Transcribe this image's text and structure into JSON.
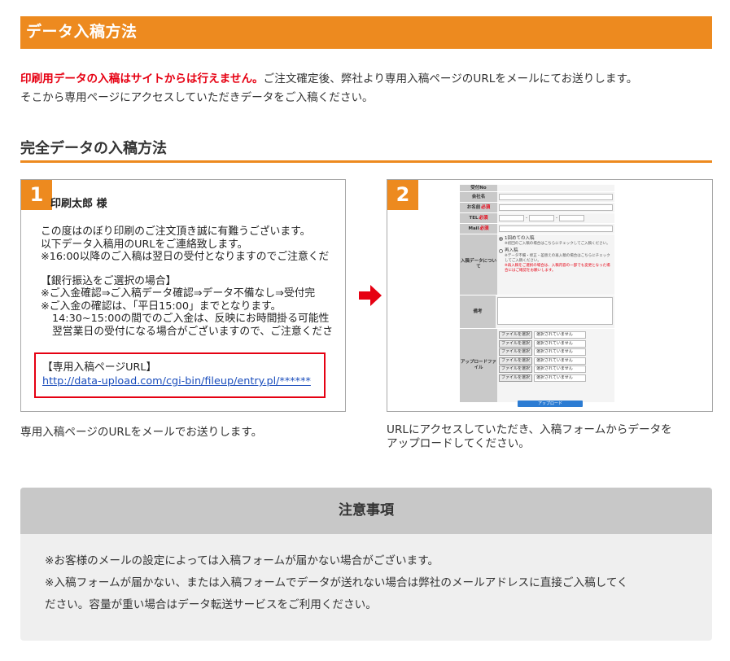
{
  "section": {
    "title": "データ入稿方法"
  },
  "intro": {
    "warning": "印刷用データの入稿はサイトからは行えません。",
    "text1": "ご注文確定後、弊社より専用入稿ページのURLをメールにてお送りします。",
    "text2": "そこから専用ページにアクセスしていただきデータをご入稿ください。"
  },
  "subsection": {
    "title": "完全データの入稿方法"
  },
  "step1": {
    "number": "1",
    "recipient": "印刷太郎  様",
    "lines": [
      "この度はのぼり印刷のご注文頂き誠に有難うございます。",
      "以下データ入稿用のURLをご連絡致します。",
      "※16:00以降のご入稿は翌日の受付となりますのでご注意くだ"
    ],
    "bank_lines": [
      "【銀行振込をご選択の場合】",
      "※ご入金確認⇒ご入稿データ確認⇒データ不備なし⇒受付完",
      "※ご入金の確認は、「平日15:00」までとなります。",
      "14:30~15:00の間でのご入金は、反映にお時間掛る可能性",
      "翌営業日の受付になる場合がございますので、ご注意くださ"
    ],
    "url_label": "【専用入稿ページURL】",
    "url": "http://data-upload.com/cgi-bin/fileup/entry.pl/******",
    "caption": "専用入稿ページのURLをメールでお送りします。"
  },
  "arrow": {
    "icon": "right-arrow-icon",
    "color": "#e60012"
  },
  "step2": {
    "number": "2",
    "form": {
      "labels": {
        "receipt_no": "受付No",
        "company": "会社名",
        "name": "お名前",
        "tel": "TEL",
        "mail": "Mail",
        "data_about": "入稿データについて",
        "remarks": "備考",
        "upload": "アップロードファイル"
      },
      "required_mark": "必須",
      "tel_sep": "-",
      "radio1": "1回めての入稿",
      "radio1_note": "※初回のご入稿の場合はこちらにチェックしてご入稿ください。",
      "radio2": "再入稿",
      "radio2_note": "※データ不備・修正・差替えの再入稿の場合はこちらにチェックしてご入稿ください。",
      "red_note": "※再入稿をご選択の場合は、入稿内容の一部でも変更となった場合にはご確認をお願いします。",
      "file_button": "ファイルを選択",
      "file_status": "選択されていません",
      "upload_button": "アップロード"
    },
    "caption_line1": "URLにアクセスしていただき、入稿フォームからデータを",
    "caption_line2": "アップロードしてください。"
  },
  "notice": {
    "title": "注意事項",
    "line1": "※お客様のメールの設定によっては入稿フォームが届かない場合がございます。",
    "line2": "※入稿フォームが届かない、または入稿フォームでデータが送れない場合は弊社のメールアドレスに直接ご入稿してく",
    "line3": "ださい。容量が重い場合はデータ転送サービスをご利用ください。"
  },
  "colors": {
    "accent": "#ed8a1f",
    "warning": "#e60012",
    "link": "#1a4dbc",
    "upload_button": "#2c7cd3"
  }
}
